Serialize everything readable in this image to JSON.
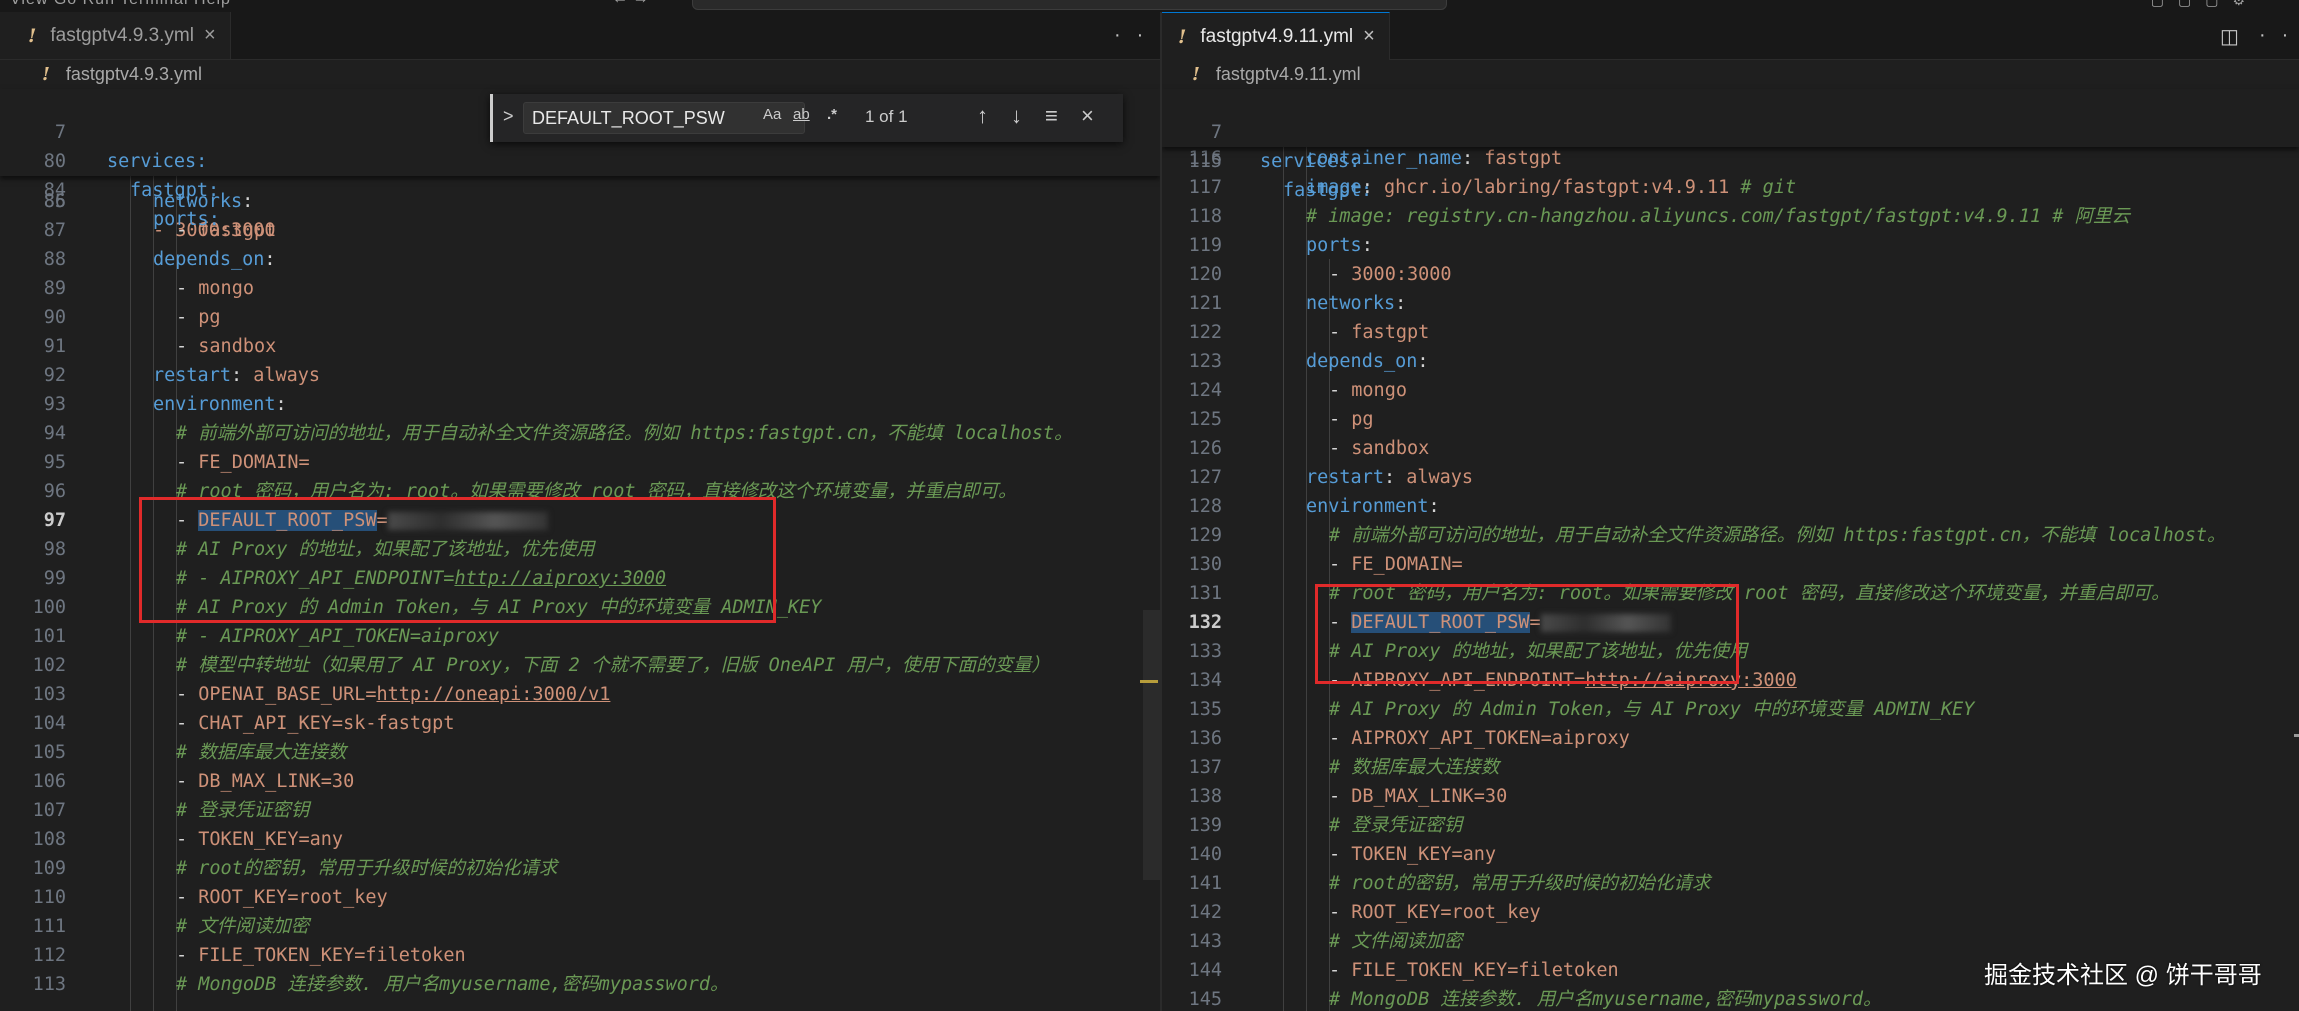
{
  "titlebar": {
    "menus": "View   Go   Run   Terminal   Help",
    "nav": "←   →"
  },
  "left_editor": {
    "tab_label": "fastgptv4.9.3.yml",
    "tab_modified_mark": "!",
    "tab_close": "×",
    "more_actions": "···",
    "breadcrumb": "fastgptv4.9.3.yml",
    "sticky": [
      {
        "num": "7",
        "text": "services:"
      },
      {
        "num": "80",
        "text": "fastgpt:"
      },
      {
        "num": "84",
        "text": "ports:"
      }
    ],
    "partial_line": "- 3000:3000",
    "partial_num": "85",
    "lines": [
      {
        "num": "86",
        "text": "networks:"
      },
      {
        "num": "87",
        "text": "- fastgpt"
      },
      {
        "num": "88",
        "text": "depends_on:"
      },
      {
        "num": "89",
        "text": "- mongo"
      },
      {
        "num": "90",
        "text": "- pg"
      },
      {
        "num": "91",
        "text": "- sandbox"
      },
      {
        "num": "92",
        "text": "restart: always"
      },
      {
        "num": "93",
        "text": "environment:"
      },
      {
        "num": "94",
        "text": "# 前端外部可访问的地址，用于自动补全文件资源路径。例如 https:fastgpt.cn，不能填 localhost。"
      },
      {
        "num": "95",
        "text": "- FE_DOMAIN="
      },
      {
        "num": "96",
        "text": "# root 密码，用户名为: root。如果需要修改 root 密码，直接修改这个环境变量，并重启即可。"
      },
      {
        "num": "97",
        "text": "- DEFAULT_ROOT_PSW="
      },
      {
        "num": "98",
        "text": "# AI Proxy 的地址，如果配了该地址，优先使用"
      },
      {
        "num": "99",
        "text": "# - AIPROXY_API_ENDPOINT=http://aiproxy:3000"
      },
      {
        "num": "100",
        "text": "# AI Proxy 的 Admin Token，与 AI Proxy 中的环境变量 ADMIN_KEY"
      },
      {
        "num": "101",
        "text": "# - AIPROXY_API_TOKEN=aiproxy"
      },
      {
        "num": "102",
        "text": "# 模型中转地址（如果用了 AI Proxy，下面 2 个就不需要了，旧版 OneAPI 用户，使用下面的变量）"
      },
      {
        "num": "103",
        "text": "- OPENAI_BASE_URL=http://oneapi:3000/v1"
      },
      {
        "num": "104",
        "text": "- CHAT_API_KEY=sk-fastgpt"
      },
      {
        "num": "105",
        "text": "# 数据库最大连接数"
      },
      {
        "num": "106",
        "text": "- DB_MAX_LINK=30"
      },
      {
        "num": "107",
        "text": "# 登录凭证密钥"
      },
      {
        "num": "108",
        "text": "- TOKEN_KEY=any"
      },
      {
        "num": "109",
        "text": "# root的密钥，常用于升级时候的初始化请求"
      },
      {
        "num": "110",
        "text": "- ROOT_KEY=root_key"
      },
      {
        "num": "111",
        "text": "# 文件阅读加密"
      },
      {
        "num": "112",
        "text": "- FILE_TOKEN_KEY=filetoken"
      },
      {
        "num": "113",
        "text": "# MongoDB 连接参数. 用户名myusername,密码mypassword。"
      }
    ],
    "current_line": "97"
  },
  "find_widget": {
    "query": "DEFAULT_ROOT_PSW",
    "match_case": "Aa",
    "whole_word": "ab",
    "regex": ".*",
    "result": "1 of 1",
    "prev": "↑",
    "next": "↓",
    "selection": "≡",
    "close": "×",
    "toggle": ">"
  },
  "right_editor": {
    "tab_label": "fastgptv4.9.11.yml",
    "tab_modified_mark": "!",
    "tab_close": "×",
    "split_icon": "◫",
    "more_actions": "···",
    "breadcrumb": "fastgptv4.9.11.yml",
    "sticky": [
      {
        "num": "7",
        "text": "services:"
      },
      {
        "num": "115",
        "text": "fastgpt:"
      }
    ],
    "lines": [
      {
        "num": "116",
        "text": "container_name: fastgpt"
      },
      {
        "num": "117",
        "text": "image: ghcr.io/labring/fastgpt:v4.9.11 # git"
      },
      {
        "num": "118",
        "text": "# image: registry.cn-hangzhou.aliyuncs.com/fastgpt/fastgpt:v4.9.11 # 阿里云"
      },
      {
        "num": "119",
        "text": "ports:"
      },
      {
        "num": "120",
        "text": "- 3000:3000"
      },
      {
        "num": "121",
        "text": "networks:"
      },
      {
        "num": "122",
        "text": "- fastgpt"
      },
      {
        "num": "123",
        "text": "depends_on:"
      },
      {
        "num": "124",
        "text": "- mongo"
      },
      {
        "num": "125",
        "text": "- pg"
      },
      {
        "num": "126",
        "text": "- sandbox"
      },
      {
        "num": "127",
        "text": "restart: always"
      },
      {
        "num": "128",
        "text": "environment:"
      },
      {
        "num": "129",
        "text": "# 前端外部可访问的地址，用于自动补全文件资源路径。例如 https:fastgpt.cn，不能填 localhost。"
      },
      {
        "num": "130",
        "text": "- FE_DOMAIN="
      },
      {
        "num": "131",
        "text": "# root 密码，用户名为: root。如果需要修改 root 密码，直接修改这个环境变量，并重启即可。"
      },
      {
        "num": "132",
        "text": "- DEFAULT_ROOT_PSW="
      },
      {
        "num": "133",
        "text": "# AI Proxy 的地址，如果配了该地址，优先使用"
      },
      {
        "num": "134",
        "text": "- AIPROXY_API_ENDPOINT=http://aiproxy:3000"
      },
      {
        "num": "135",
        "text": "# AI Proxy 的 Admin Token，与 AI Proxy 中的环境变量 ADMIN_KEY"
      },
      {
        "num": "136",
        "text": "- AIPROXY_API_TOKEN=aiproxy"
      },
      {
        "num": "137",
        "text": "# 数据库最大连接数"
      },
      {
        "num": "138",
        "text": "- DB_MAX_LINK=30"
      },
      {
        "num": "139",
        "text": "# 登录凭证密钥"
      },
      {
        "num": "140",
        "text": "- TOKEN_KEY=any"
      },
      {
        "num": "141",
        "text": "# root的密钥，常用于升级时候的初始化请求"
      },
      {
        "num": "142",
        "text": "- ROOT_KEY=root_key"
      },
      {
        "num": "143",
        "text": "# 文件阅读加密"
      },
      {
        "num": "144",
        "text": "- FILE_TOKEN_KEY=filetoken"
      },
      {
        "num": "145",
        "text": "# MongoDB 连接参数. 用户名myusername,密码mypassword。"
      }
    ],
    "current_line": "132"
  },
  "watermark": "掘金技术社区 @ 饼干哥哥",
  "colors": {
    "background": "#1f1f1f",
    "yaml_key": "#569cd6",
    "yaml_value": "#ce9178",
    "comment": "#6a9955",
    "highlight_box": "#e02a2a",
    "selection": "#264f78"
  }
}
